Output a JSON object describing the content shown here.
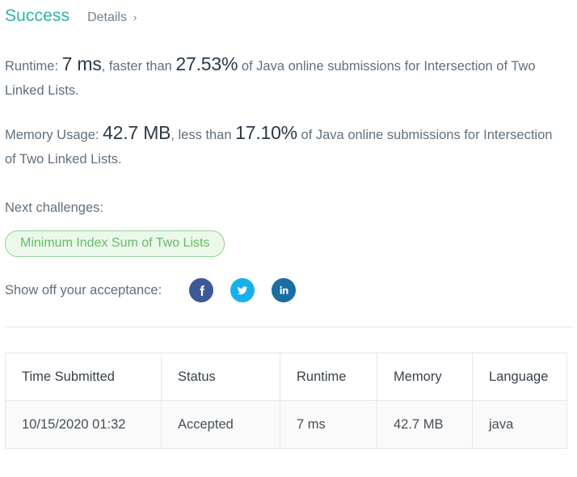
{
  "header": {
    "status_title": "Success",
    "details_label": "Details",
    "chevron": "›"
  },
  "runtime_line": {
    "label": "Runtime:",
    "value": "7 ms",
    "comparator": ", faster than",
    "percentile": "27.53%",
    "suffix": "of Java online submissions for Intersection of Two Linked Lists."
  },
  "memory_line": {
    "label": "Memory Usage:",
    "value": "42.7 MB",
    "comparator": ", less than",
    "percentile": "17.10%",
    "suffix": "of Java online submissions for Intersection of Two Linked Lists."
  },
  "next_challenges": {
    "label": "Next challenges:",
    "items": [
      {
        "title": "Minimum Index Sum of Two Lists"
      }
    ]
  },
  "share": {
    "label": "Show off your acceptance:",
    "networks": [
      {
        "name": "facebook",
        "icon": "facebook-icon",
        "color": "#3b5998"
      },
      {
        "name": "twitter",
        "icon": "twitter-icon",
        "color": "#18b0ec"
      },
      {
        "name": "linkedin",
        "icon": "linkedin-icon",
        "color": "#1a6ea3"
      }
    ]
  },
  "submissions_table": {
    "columns": [
      "Time Submitted",
      "Status",
      "Runtime",
      "Memory",
      "Language"
    ],
    "rows": [
      {
        "time_submitted": "10/15/2020 01:32",
        "status": "Accepted",
        "runtime": "7 ms",
        "memory": "42.7 MB",
        "language": "java"
      }
    ]
  },
  "colors": {
    "success_teal": "#2cb3a6",
    "body_gray": "#60707e",
    "emphasis_dark": "#2b3a47",
    "pill_green": "#63bd63",
    "pill_bg": "#edf8ed",
    "pill_border": "#93cf93"
  }
}
